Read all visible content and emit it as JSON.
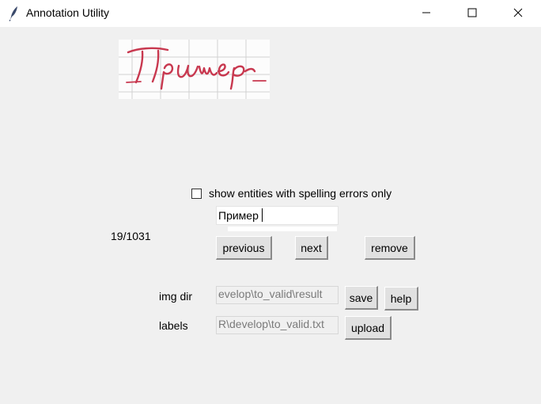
{
  "window": {
    "title": "Annotation Utility",
    "icon": "feather-icon",
    "controls": [
      "minimize-icon",
      "maximize-icon",
      "close-icon"
    ]
  },
  "preview": {
    "word": "Пример",
    "ink_color": "#c8384f",
    "grid_color": "#cfcfcf"
  },
  "filter": {
    "label": "show entities with spelling errors only",
    "checked": false
  },
  "entity": {
    "value": "Пример"
  },
  "counter": {
    "text": "19/1031"
  },
  "nav": {
    "previous_label": "previous",
    "next_label": "next",
    "remove_label": "remove"
  },
  "paths": {
    "img_dir_label": "img dir",
    "img_dir_value": "evelop\\to_valid\\result",
    "labels_label": "labels",
    "labels_value": "R\\develop\\to_valid.txt"
  },
  "actions": {
    "save_label": "save",
    "help_label": "help",
    "upload_label": "upload"
  }
}
